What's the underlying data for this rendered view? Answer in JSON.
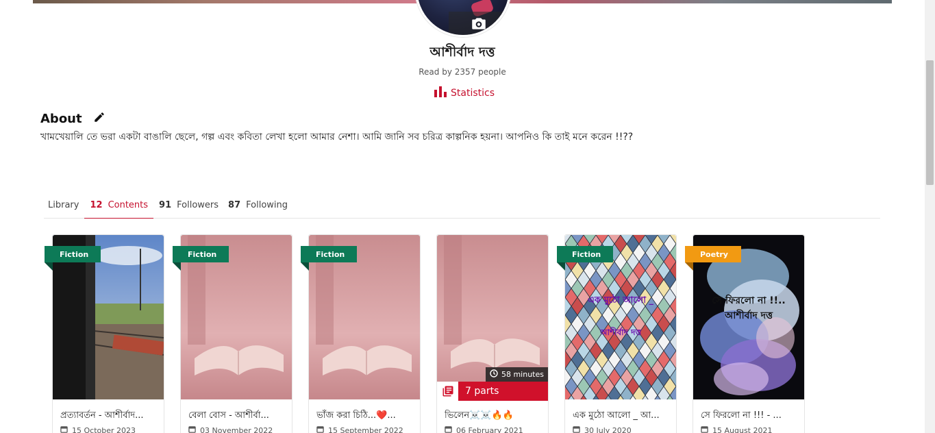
{
  "profile": {
    "name": "আশীর্বাদ দত্ত",
    "read_by": "Read by 2357 people",
    "statistics_label": "Statistics"
  },
  "about": {
    "title": "About",
    "text": "খামখেয়ালি তে ভরা একটা বাঙালি ছেলে, গল্প এবং কবিতা লেখা হলো আমার নেশা। আমি জানি সব চরিত্র কাল্পনিক হয়না। আপনিও কি তাই মনে করেন !!??"
  },
  "tabs": [
    {
      "num": "",
      "label": "Library"
    },
    {
      "num": "12",
      "label": "Contents"
    },
    {
      "num": "91",
      "label": "Followers"
    },
    {
      "num": "87",
      "label": "Following"
    }
  ],
  "cards": [
    {
      "badge": "Fiction",
      "title": "প্রত্যাবর্তন - আশীর্বাদ...",
      "date": "15 October 2023"
    },
    {
      "badge": "Fiction",
      "title": "বেলা বোস - আশীর্বা...",
      "date": "03 November 2022"
    },
    {
      "badge": "Fiction",
      "title": "ভাঁজ করা চিঠি...❤️...",
      "date": "15 September 2022"
    },
    {
      "badge": "",
      "title": "ভিলেন☠️☠️🔥🔥",
      "date": "06 February 2021",
      "read_time": "58 minutes",
      "parts": "7 parts"
    },
    {
      "badge": "Fiction",
      "title": "এক মুঠো আলো _ আ...",
      "date": "30 July 2020",
      "cover_line1": "এক মুঠো আলো _",
      "cover_line2": "আশীর্বাদ দত্ত"
    },
    {
      "badge": "Poetry",
      "title": "সে ফিরলো না !!! - ...",
      "date": "15 August 2021",
      "cover_line1": "সে ফিরলো না !!..",
      "cover_line2": "আশীর্বাদ দত্ত"
    }
  ],
  "colors": {
    "accent": "#c5112e",
    "fiction_badge": "#0d7a57",
    "poetry_badge": "#f29a12"
  }
}
